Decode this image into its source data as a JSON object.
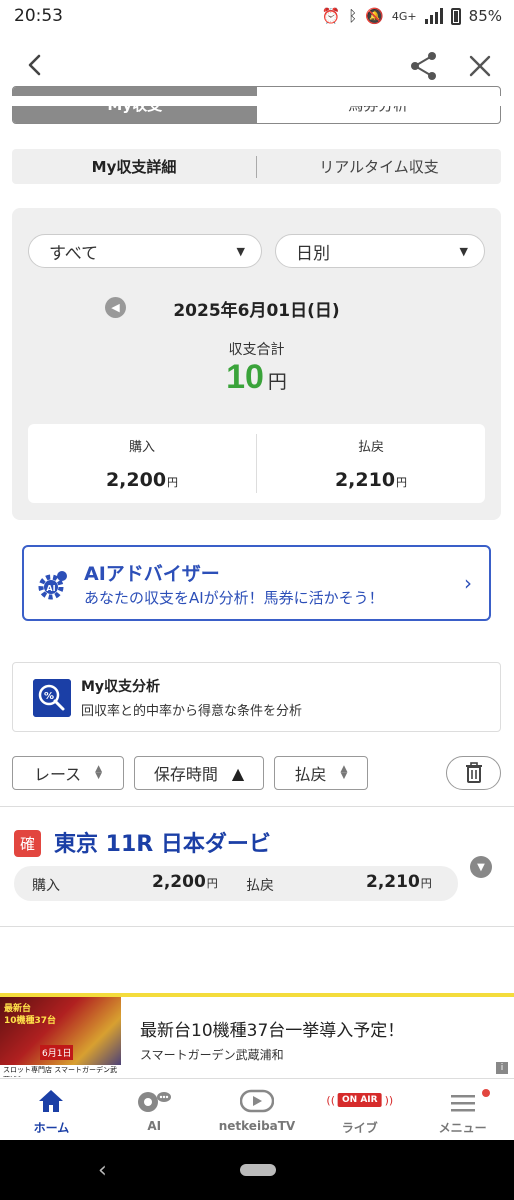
{
  "status_bar": {
    "time": "20:53",
    "network": "4G+",
    "battery": "85%"
  },
  "tabs_main": [
    {
      "label": "My収支",
      "active": true
    },
    {
      "label": "馬券分析",
      "active": false
    }
  ],
  "tabs_sub": [
    {
      "label": "My収支詳細",
      "active": true
    },
    {
      "label": "リアルタイム収支",
      "active": false
    }
  ],
  "summary": {
    "filter_type": "すべて",
    "filter_period": "日別",
    "date": "2025年6月01日(日)",
    "total_label": "収支合計",
    "total_value": "10",
    "total_unit": "円",
    "purchase_label": "購入",
    "purchase_value": "2,200",
    "purchase_unit": "円",
    "payout_label": "払戻",
    "payout_value": "2,210",
    "payout_unit": "円",
    "total_color": "#3aa33a"
  },
  "ai_advisor": {
    "title": "AIアドバイザー",
    "description": "あなたの収支をAIが分析！馬券に活かそう！",
    "icon": "ai-gear-icon"
  },
  "analysis": {
    "title": "My収支分析",
    "description": "回収率と的中率から得意な条件を分析",
    "icon": "percent-search-icon"
  },
  "filters": {
    "race": "レース",
    "saved_time": "保存時間",
    "payout": "払戻"
  },
  "race_item": {
    "badge": "確",
    "title": "東京 11R 日本ダービ",
    "purchase_label": "購入",
    "purchase_value": "2,200",
    "purchase_unit": "円",
    "payout_label": "払戻",
    "payout_value": "2,210",
    "payout_unit": "円"
  },
  "ad": {
    "title": "最新台10機種37台一挙導入予定！",
    "sub": "スマートガーデン武蔵浦和",
    "image_text1": "最新台",
    "image_text2": "10機種37台",
    "image_text3": "6月1日",
    "image_text4": "スロット専門店 スマートガーデン武蔵浦和",
    "info": "i"
  },
  "bottom_tabs": [
    {
      "label": "ホーム",
      "icon": "home-icon",
      "active": true
    },
    {
      "label": "AI",
      "icon": "ai-head-icon",
      "active": false
    },
    {
      "label": "netkeibaTV",
      "icon": "tv-play-icon",
      "active": false
    },
    {
      "label": "ライブ",
      "icon": "on-air-icon",
      "badge": "ON AIR",
      "active": false
    },
    {
      "label": "メニュー",
      "icon": "menu-icon",
      "active": false
    }
  ],
  "colors": {
    "accent_blue": "#1b3fa6",
    "link_blue": "#2c4fb8",
    "confirm_red": "#e2463f",
    "ad_yellow": "#f4dc3c"
  }
}
